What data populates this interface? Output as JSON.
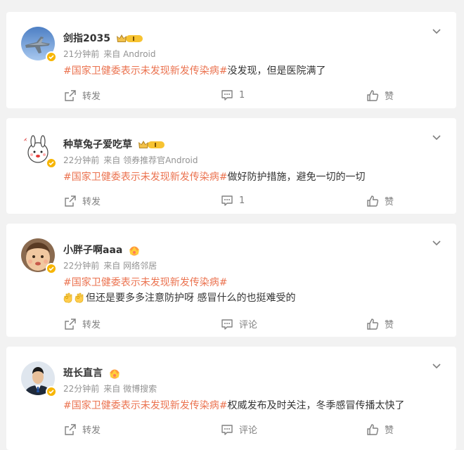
{
  "posts": [
    {
      "username": "剑指2035",
      "time": "21分钟前",
      "source": "来自 Android",
      "topic": "#国家卫健委表示未发现新发传染病#",
      "text": "没发现，但是医院满了",
      "repost": "转发",
      "comment": "1",
      "like": "赞",
      "avatar_icon": "jet-fighter-avatar",
      "badge_level": "1"
    },
    {
      "username": "种草兔子爱吃草",
      "time": "22分钟前",
      "source": "来自 领券推荐官Android",
      "topic": "#国家卫健委表示未发现新发传染病#",
      "text": "做好防护措施，避免一切的一切",
      "repost": "转发",
      "comment": "1",
      "like": "赞",
      "avatar_icon": "cartoon-rabbit-avatar",
      "badge_level": "1"
    },
    {
      "username": "小胖子啊aaa",
      "time": "22分钟前",
      "source": "来自 网络邻居",
      "topic": "#国家卫健委表示未发现新发传染病#",
      "text": "但还是要多多注意防护呀 感冒什么的也挺难受的",
      "repost": "转发",
      "comment": "评论",
      "like": "赞",
      "avatar_icon": "baby-face-avatar"
    },
    {
      "username": "班长直言",
      "time": "22分钟前",
      "source": "来自 微博搜索",
      "topic": "#国家卫健委表示未发现新发传染病#",
      "text": "权威发布及时关注，冬季感冒传播太快了",
      "repost": "转发",
      "comment": "评论",
      "like": "赞",
      "avatar_icon": "man-in-suit-avatar"
    }
  ],
  "colors": {
    "topic": "#eb7350",
    "background": "#f2f2f2",
    "verified_badge": "#f7b500"
  }
}
